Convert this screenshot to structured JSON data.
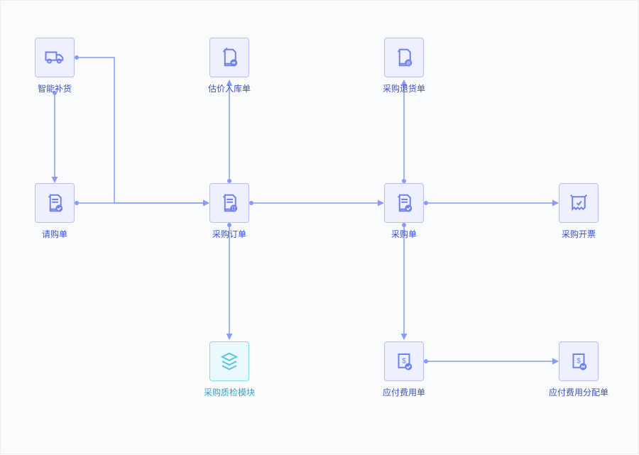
{
  "nodes": {
    "smart_replenish": {
      "label": "智能补货",
      "icon": "truck"
    },
    "purchase_request": {
      "label": "请购单",
      "icon": "doc-check"
    },
    "valuation_inbound": {
      "label": "估价入库单",
      "icon": "doc-arrow"
    },
    "purchase_order": {
      "label": "采购订单",
      "icon": "doc-order"
    },
    "purchase_return": {
      "label": "采购退货单",
      "icon": "doc-return"
    },
    "purchase_receipt": {
      "label": "采购单",
      "icon": "doc-check"
    },
    "purchase_invoice": {
      "label": "采购开票",
      "icon": "invoice"
    },
    "quality_module": {
      "label": "采购质检模块",
      "icon": "stack"
    },
    "payable_expense": {
      "label": "应付费用单",
      "icon": "money-check"
    },
    "payable_allocation": {
      "label": "应付费用分配单",
      "icon": "money-share"
    }
  },
  "colors": {
    "purple_stroke": "#6e7ff2",
    "purple_fill": "#8a99f5",
    "teal_stroke": "#5cc2de"
  }
}
